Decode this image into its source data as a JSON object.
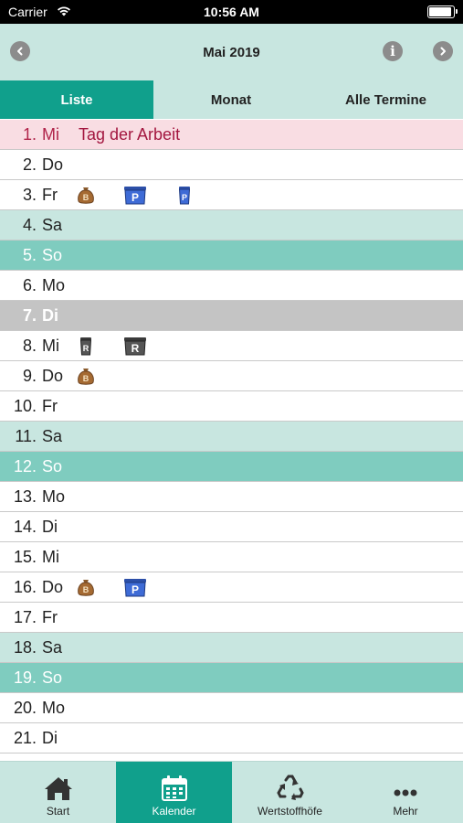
{
  "status_bar": {
    "carrier": "Carrier",
    "time": "10:56 AM"
  },
  "header": {
    "title": "Mai 2019",
    "prev_icon": "chevron-left-icon",
    "next_icon": "chevron-right-icon",
    "info_icon": "info-icon",
    "info_glyph": "i"
  },
  "tabs": [
    {
      "label": "Liste",
      "active": true
    },
    {
      "label": "Monat",
      "active": false
    },
    {
      "label": "Alle Termine",
      "active": false
    }
  ],
  "days": [
    {
      "day": "1.",
      "name": "Mi",
      "type": "holiday",
      "event": "Tag der Arbeit",
      "icons": []
    },
    {
      "day": "2.",
      "name": "Do",
      "type": "normal",
      "icons": []
    },
    {
      "day": "3.",
      "name": "Fr",
      "type": "normal",
      "icons": [
        "money-bag-icon",
        "blue-bin-p-icon",
        "blue-small-bin-p-icon"
      ]
    },
    {
      "day": "4.",
      "name": "Sa",
      "type": "sat",
      "icons": []
    },
    {
      "day": "5.",
      "name": "So",
      "type": "sun",
      "icons": []
    },
    {
      "day": "6.",
      "name": "Mo",
      "type": "normal",
      "icons": []
    },
    {
      "day": "7.",
      "name": "Di",
      "type": "gray",
      "icons": []
    },
    {
      "day": "8.",
      "name": "Mi",
      "type": "normal",
      "icons": [
        "gray-small-bin-r-icon",
        "gray-bin-r-icon"
      ]
    },
    {
      "day": "9.",
      "name": "Do",
      "type": "normal",
      "icons": [
        "money-bag-icon"
      ]
    },
    {
      "day": "10.",
      "name": "Fr",
      "type": "normal",
      "icons": []
    },
    {
      "day": "11.",
      "name": "Sa",
      "type": "sat",
      "icons": []
    },
    {
      "day": "12.",
      "name": "So",
      "type": "sun",
      "icons": []
    },
    {
      "day": "13.",
      "name": "Mo",
      "type": "normal",
      "icons": []
    },
    {
      "day": "14.",
      "name": "Di",
      "type": "normal",
      "icons": []
    },
    {
      "day": "15.",
      "name": "Mi",
      "type": "normal",
      "icons": []
    },
    {
      "day": "16.",
      "name": "Do",
      "type": "normal",
      "icons": [
        "money-bag-icon",
        "blue-bin-p-icon"
      ]
    },
    {
      "day": "17.",
      "name": "Fr",
      "type": "normal",
      "icons": []
    },
    {
      "day": "18.",
      "name": "Sa",
      "type": "sat",
      "icons": []
    },
    {
      "day": "19.",
      "name": "So",
      "type": "sun",
      "icons": []
    },
    {
      "day": "20.",
      "name": "Mo",
      "type": "normal",
      "icons": []
    },
    {
      "day": "21.",
      "name": "Di",
      "type": "normal",
      "icons": []
    }
  ],
  "tab_bar": [
    {
      "label": "Start",
      "icon": "home-icon",
      "active": false
    },
    {
      "label": "Kalender",
      "icon": "calendar-icon",
      "active": true
    },
    {
      "label": "Wertstoffhöfe",
      "icon": "recycle-icon",
      "active": false
    },
    {
      "label": "Mehr",
      "icon": "more-icon",
      "active": false
    }
  ],
  "colors": {
    "accent": "#10a08c",
    "header_bg": "#c8e6e0",
    "saturday": "#c8e6e0",
    "sunday": "#7fccbf",
    "holiday_bg": "#f9dde3",
    "holiday_text": "#b0244a"
  }
}
